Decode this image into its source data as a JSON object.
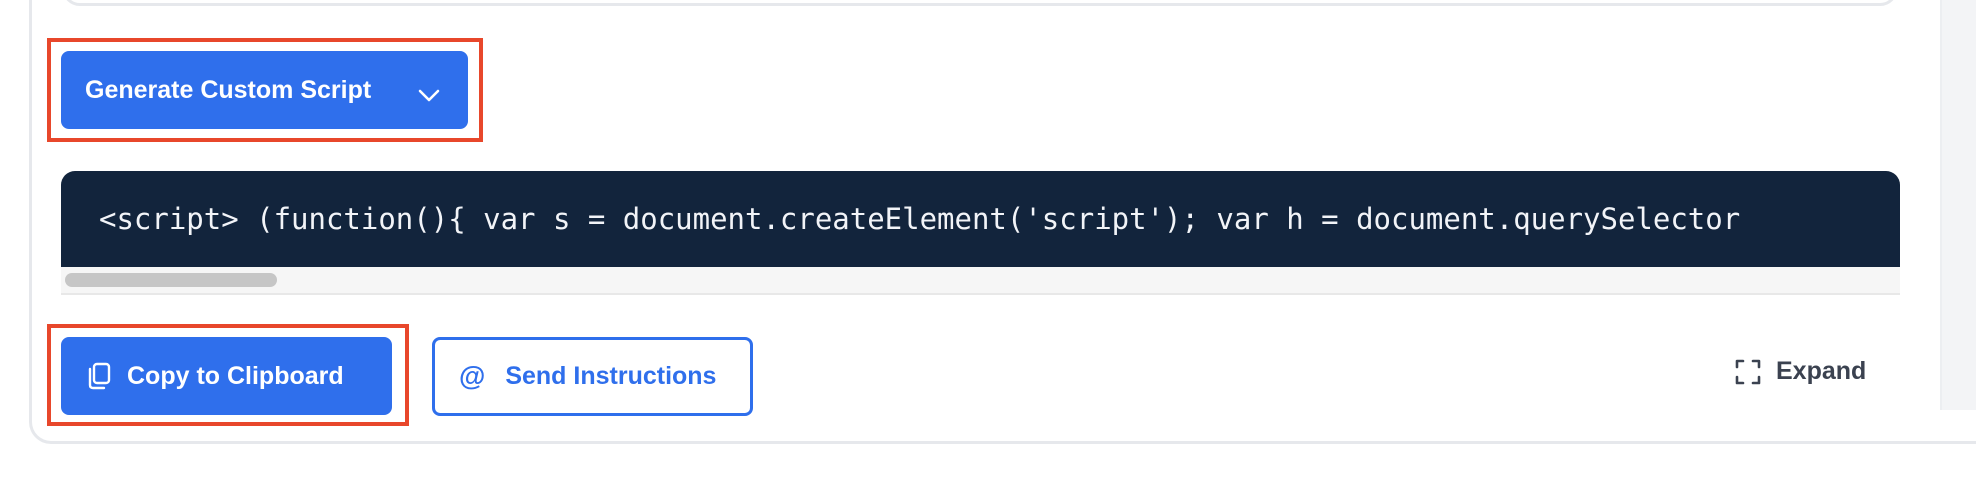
{
  "buttons": {
    "generate_label": "Generate Custom Script",
    "copy_label": "Copy to Clipboard",
    "send_label": "Send Instructions",
    "expand_label": "Expand"
  },
  "code": {
    "snippet": "<script> (function(){ var s = document.createElement('script'); var h = document.querySelector"
  },
  "icons": {
    "generate_dropdown": "chevron-down-icon",
    "copy": "copy-icon",
    "send": "at-sign-icon",
    "expand": "expand-icon"
  },
  "colors": {
    "primary": "#2f6fec",
    "code_bg": "#12243c",
    "highlight": "#e8472b",
    "expand_text": "#3b4250"
  }
}
